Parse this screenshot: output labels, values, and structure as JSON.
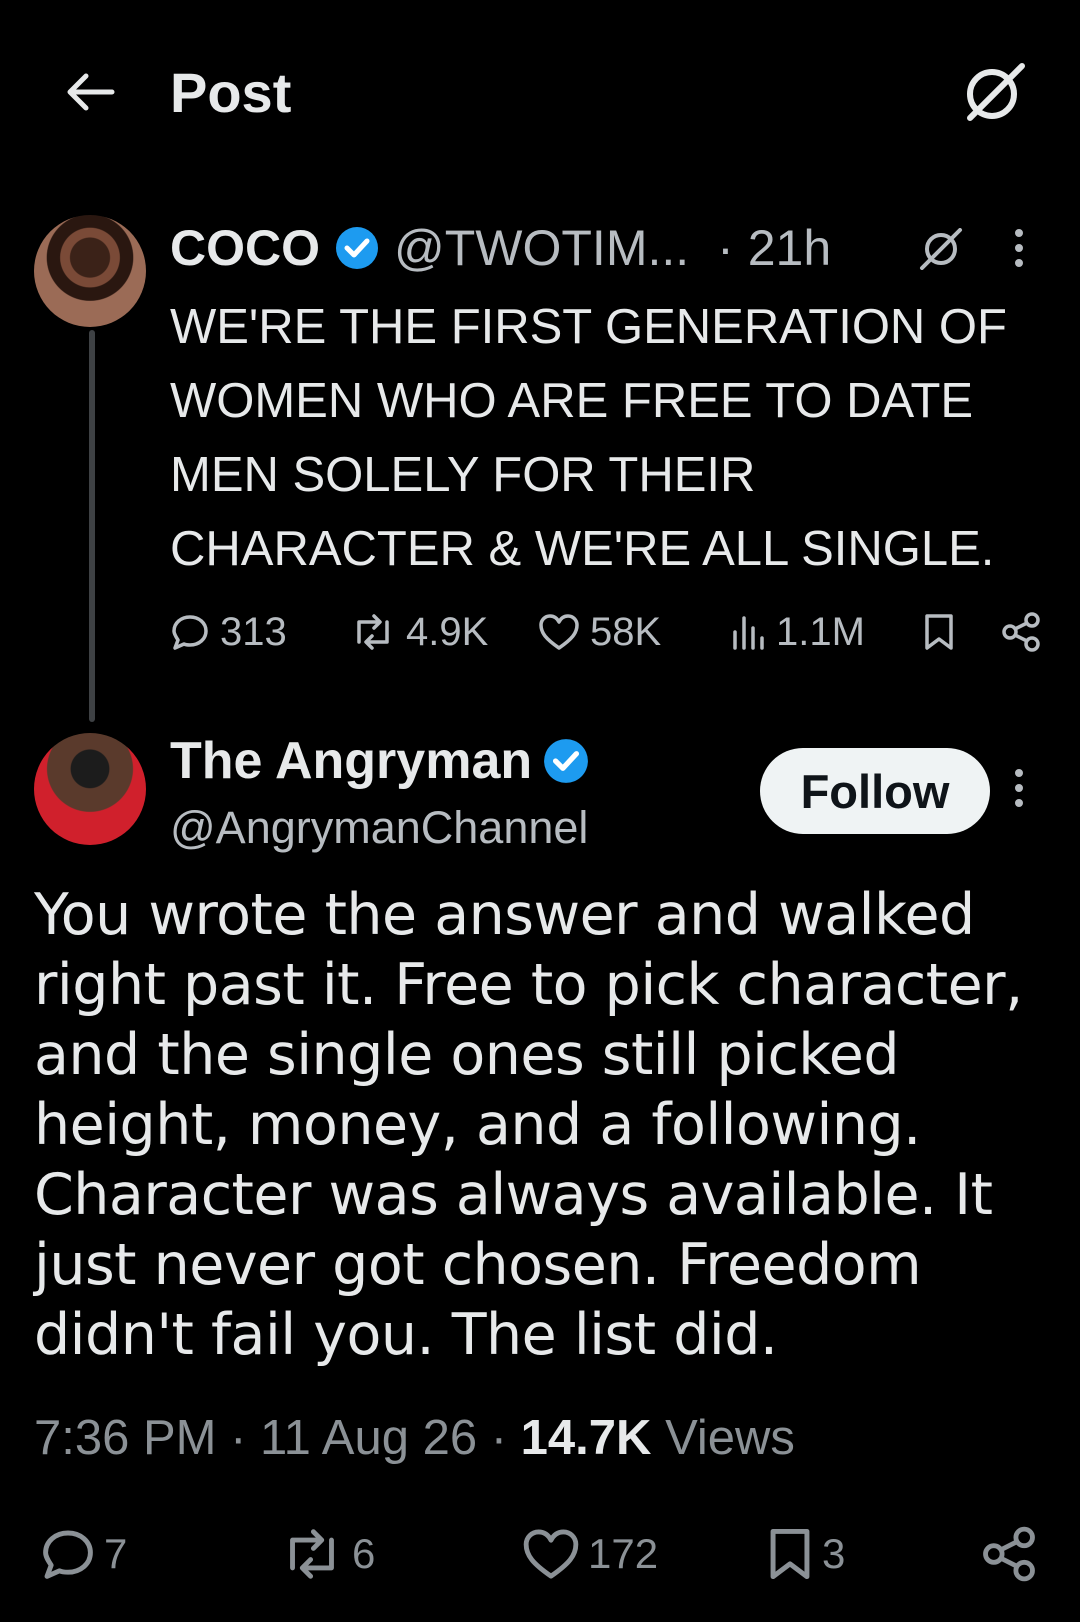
{
  "header": {
    "title": "Post",
    "back_icon": "back-arrow-icon",
    "grok_icon": "grok-icon"
  },
  "parent_tweet": {
    "name": "COCO",
    "handle": "@TWOTIM...",
    "time": "· 21h",
    "text": "WE'RE THE FIRST GENERATION OF WOMEN WHO ARE FREE TO DATE MEN SOLELY FOR THEIR CHARACTER & WE'RE ALL SINGLE.",
    "stats": {
      "replies": "313",
      "reposts": "4.9K",
      "likes": "58K",
      "views": "1.1M"
    }
  },
  "main_tweet": {
    "name": "The Angryman",
    "handle": "@AngrymanChannel",
    "follow_label": "Follow",
    "text": "You wrote the answer and walked right past it. Free to pick character, and the single ones still picked height, money, and a following. Character was always available. It just never got chosen. Freedom didn't fail you. The list did.",
    "time": "7:36 PM",
    "date": "11 Aug 26",
    "views_count": "14.7K",
    "views_label": "Views",
    "stats": {
      "replies": "7",
      "reposts": "6",
      "likes": "172",
      "bookmarks": "3"
    }
  },
  "colors": {
    "background": "#000000",
    "text": "#e7e9ea",
    "muted": "#8b9196",
    "verified": "#1d9bf0",
    "follow_bg": "#eff3f4"
  }
}
